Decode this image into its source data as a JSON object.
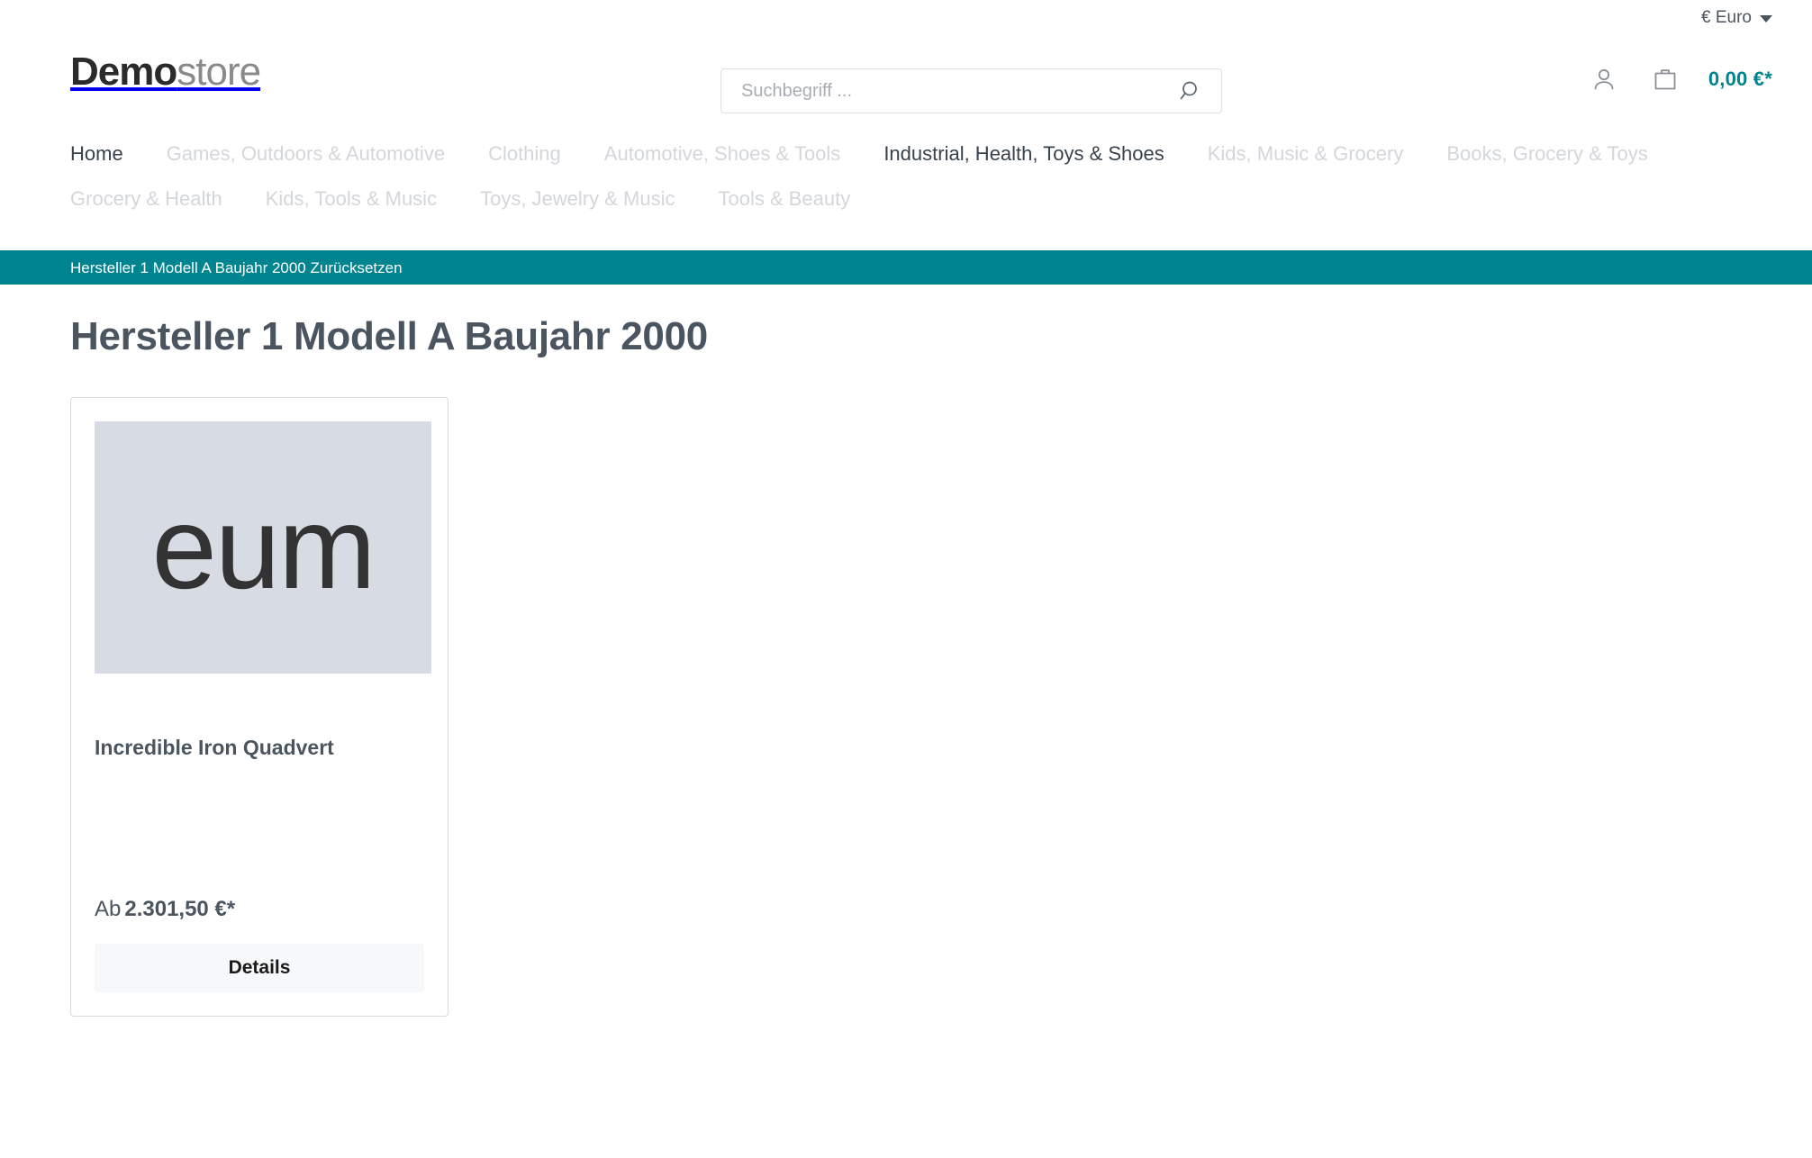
{
  "topbar": {
    "currency_symbol": "€",
    "currency_label": "Euro",
    "currency_display": "€ Euro"
  },
  "header": {
    "logo_bold": "Demo",
    "logo_light": "store",
    "search": {
      "placeholder": "Suchbegriff ...",
      "value": "",
      "icon": "search-icon"
    },
    "account_icon": "user-icon",
    "cart_icon": "shopping-bag-icon",
    "cart_total": "0,00 €*"
  },
  "nav": {
    "items": [
      {
        "label": "Home",
        "active": true
      },
      {
        "label": "Games, Outdoors & Automotive",
        "active": false
      },
      {
        "label": "Clothing",
        "active": false
      },
      {
        "label": "Automotive, Shoes & Tools",
        "active": false
      },
      {
        "label": "Industrial, Health, Toys & Shoes",
        "active": true
      },
      {
        "label": "Kids, Music & Grocery",
        "active": false
      },
      {
        "label": "Books, Grocery & Toys",
        "active": false
      },
      {
        "label": "Grocery & Health",
        "active": false
      },
      {
        "label": "Kids, Tools & Music",
        "active": false
      },
      {
        "label": "Toys, Jewelry & Music",
        "active": false
      },
      {
        "label": "Tools & Beauty",
        "active": false
      }
    ]
  },
  "filter_bar": {
    "text": "Hersteller 1 Modell A Baujahr 2000 Zurücksetzen"
  },
  "main": {
    "title": "Hersteller 1 Modell A Baujahr 2000",
    "products": [
      {
        "image_text": "eum",
        "name": "Incredible Iron Quadvert",
        "price_prefix": "Ab",
        "price": "2.301,50 €*",
        "details_label": "Details"
      }
    ]
  },
  "colors": {
    "accent_teal": "#008490",
    "text_dark": "#4a5560",
    "nav_muted": "#d3d6da",
    "image_placeholder": "#d7dbe3"
  }
}
